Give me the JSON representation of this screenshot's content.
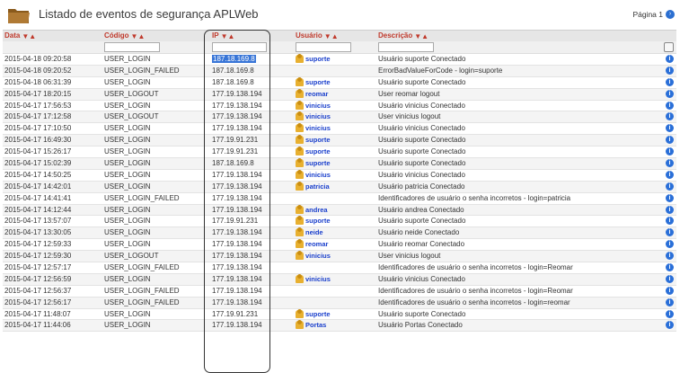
{
  "header": {
    "title": "Listado de eventos de segurança APLWeb",
    "page_label": "Página 1"
  },
  "columns": [
    {
      "label": "Data"
    },
    {
      "label": "Código"
    },
    {
      "label": "IP"
    },
    {
      "label": "Usuário"
    },
    {
      "label": "Descrição"
    }
  ],
  "rows": [
    {
      "date": "2015-04-18 09:20:58",
      "code": "USER_LOGIN",
      "ip": "187.18.169.8",
      "user": "suporte",
      "desc": "Usuário suporte Conectado",
      "ip_selected": true
    },
    {
      "date": "2015-04-18 09:20:52",
      "code": "USER_LOGIN_FAILED",
      "ip": "187.18.169.8",
      "user": "",
      "desc": "ErrorBadValueForCode - login=suporte"
    },
    {
      "date": "2015-04-18 06:31:39",
      "code": "USER_LOGIN",
      "ip": "187.18.169.8",
      "user": "suporte",
      "desc": "Usuário suporte Conectado"
    },
    {
      "date": "2015-04-17 18:20:15",
      "code": "USER_LOGOUT",
      "ip": "177.19.138.194",
      "user": "reomar",
      "desc": "User reomar logout"
    },
    {
      "date": "2015-04-17 17:56:53",
      "code": "USER_LOGIN",
      "ip": "177.19.138.194",
      "user": "vinicius",
      "desc": "Usuário vinicius Conectado"
    },
    {
      "date": "2015-04-17 17:12:58",
      "code": "USER_LOGOUT",
      "ip": "177.19.138.194",
      "user": "vinicius",
      "desc": "User vinicius logout"
    },
    {
      "date": "2015-04-17 17:10:50",
      "code": "USER_LOGIN",
      "ip": "177.19.138.194",
      "user": "vinicius",
      "desc": "Usuário vinicius Conectado"
    },
    {
      "date": "2015-04-17 16:49:30",
      "code": "USER_LOGIN",
      "ip": "177.19.91.231",
      "user": "suporte",
      "desc": "Usuário suporte Conectado"
    },
    {
      "date": "2015-04-17 15:26:17",
      "code": "USER_LOGIN",
      "ip": "177.19.91.231",
      "user": "suporte",
      "desc": "Usuário suporte Conectado"
    },
    {
      "date": "2015-04-17 15:02:39",
      "code": "USER_LOGIN",
      "ip": "187.18.169.8",
      "user": "suporte",
      "desc": "Usuário suporte Conectado"
    },
    {
      "date": "2015-04-17 14:50:25",
      "code": "USER_LOGIN",
      "ip": "177.19.138.194",
      "user": "vinicius",
      "desc": "Usuário vinicius Conectado"
    },
    {
      "date": "2015-04-17 14:42:01",
      "code": "USER_LOGIN",
      "ip": "177.19.138.194",
      "user": "patricia",
      "desc": "Usuário patricia Conectado"
    },
    {
      "date": "2015-04-17 14:41:41",
      "code": "USER_LOGIN_FAILED",
      "ip": "177.19.138.194",
      "user": "",
      "desc": "Identificadores de usuário o senha incorretos - login=patricia"
    },
    {
      "date": "2015-04-17 14:12:44",
      "code": "USER_LOGIN",
      "ip": "177.19.138.194",
      "user": "andrea",
      "desc": "Usuário andrea Conectado"
    },
    {
      "date": "2015-04-17 13:57:07",
      "code": "USER_LOGIN",
      "ip": "177.19.91.231",
      "user": "suporte",
      "desc": "Usuário suporte Conectado"
    },
    {
      "date": "2015-04-17 13:30:05",
      "code": "USER_LOGIN",
      "ip": "177.19.138.194",
      "user": "neide",
      "desc": "Usuário neide Conectado"
    },
    {
      "date": "2015-04-17 12:59:33",
      "code": "USER_LOGIN",
      "ip": "177.19.138.194",
      "user": "reomar",
      "desc": "Usuário reomar Conectado"
    },
    {
      "date": "2015-04-17 12:59:30",
      "code": "USER_LOGOUT",
      "ip": "177.19.138.194",
      "user": "vinicius",
      "desc": "User vinicius logout"
    },
    {
      "date": "2015-04-17 12:57:17",
      "code": "USER_LOGIN_FAILED",
      "ip": "177.19.138.194",
      "user": "",
      "desc": "Identificadores de usuário o senha incorretos - login=Reomar"
    },
    {
      "date": "2015-04-17 12:56:59",
      "code": "USER_LOGIN",
      "ip": "177.19.138.194",
      "user": "vinicius",
      "desc": "Usuário vinicius Conectado"
    },
    {
      "date": "2015-04-17 12:56:37",
      "code": "USER_LOGIN_FAILED",
      "ip": "177.19.138.194",
      "user": "",
      "desc": "Identificadores de usuário o senha incorretos - login=Reomar"
    },
    {
      "date": "2015-04-17 12:56:17",
      "code": "USER_LOGIN_FAILED",
      "ip": "177.19.138.194",
      "user": "",
      "desc": "Identificadores de usuário o senha incorretos - login=reomar"
    },
    {
      "date": "2015-04-17 11:48:07",
      "code": "USER_LOGIN",
      "ip": "177.19.91.231",
      "user": "suporte",
      "desc": "Usuário suporte Conectado"
    },
    {
      "date": "2015-04-17 11:44:06",
      "code": "USER_LOGIN",
      "ip": "177.19.138.194",
      "user": "Portas",
      "desc": "Usuário Portas Conectado"
    }
  ]
}
